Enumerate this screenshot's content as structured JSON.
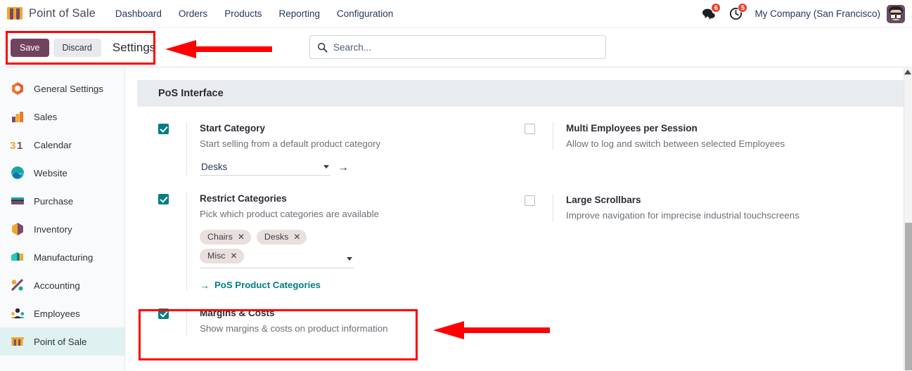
{
  "navbar": {
    "brand": "Point of Sale",
    "brand_icon": "shop-awning-icon",
    "menu": [
      {
        "label": "Dashboard"
      },
      {
        "label": "Orders"
      },
      {
        "label": "Products"
      },
      {
        "label": "Reporting"
      },
      {
        "label": "Configuration"
      }
    ],
    "messages_icon": "chat-bubbles-icon",
    "messages_count": "6",
    "activities_icon": "clock-icon",
    "activities_count": "5",
    "company": "My Company (San Francisco)",
    "avatar_icon": "user-avatar"
  },
  "control_panel": {
    "save_label": "Save",
    "discard_label": "Discard",
    "title": "Settings",
    "search_placeholder": "Search...",
    "search_value": "",
    "search_icon": "search-icon"
  },
  "sidebar": {
    "items": [
      {
        "label": "General Settings",
        "icon": "gear-settings-icon",
        "active": false
      },
      {
        "label": "Sales",
        "icon": "sales-bars-icon",
        "active": false
      },
      {
        "label": "Calendar",
        "icon": "calendar-31-icon",
        "active": false
      },
      {
        "label": "Website",
        "icon": "website-globe-icon",
        "active": false
      },
      {
        "label": "Purchase",
        "icon": "purchase-card-icon",
        "active": false
      },
      {
        "label": "Inventory",
        "icon": "inventory-box-icon",
        "active": false
      },
      {
        "label": "Manufacturing",
        "icon": "manufacturing-icon",
        "active": false
      },
      {
        "label": "Accounting",
        "icon": "accounting-percent-icon",
        "active": false
      },
      {
        "label": "Employees",
        "icon": "employees-people-icon",
        "active": false
      },
      {
        "label": "Point of Sale",
        "icon": "shop-awning-icon",
        "active": true
      }
    ]
  },
  "settings": {
    "section_title": "PoS Interface",
    "left": [
      {
        "id": "start-category",
        "checked": true,
        "title": "Start Category",
        "description": "Start selling from a default product category",
        "select_value": "Desks",
        "internal_link_icon": "arrow-right-icon"
      },
      {
        "id": "restrict-categories",
        "checked": true,
        "title": "Restrict Categories",
        "description": "Pick which product categories are available",
        "tags": [
          "Chairs",
          "Desks",
          "Misc"
        ],
        "link_label": "PoS Product Categories",
        "link_icon": "arrow-right-icon"
      },
      {
        "id": "margins-costs",
        "checked": true,
        "title": "Margins & Costs",
        "description": "Show margins & costs on product information"
      }
    ],
    "right": [
      {
        "id": "multi-employees",
        "checked": false,
        "title": "Multi Employees per Session",
        "description": "Allow to log and switch between selected Employees"
      },
      {
        "id": "large-scrollbars",
        "checked": false,
        "title": "Large Scrollbars",
        "description": "Improve navigation for imprecise industrial touchscreens"
      }
    ]
  },
  "annotations": {
    "color": "#ff0000",
    "boxes": [
      {
        "name": "save-discard-highlight"
      },
      {
        "name": "margins-costs-highlight"
      }
    ],
    "arrows": [
      {
        "name": "arrow-pointing-to-save-buttons"
      },
      {
        "name": "arrow-pointing-to-margins-costs"
      }
    ]
  },
  "colors": {
    "brand_purple": "#71435f",
    "accent_teal": "#017e84",
    "badge_red": "#e8412f",
    "annotation_red": "#ff0000",
    "sidebar_active": "#dff1f0",
    "tag_bg": "#e9dfdd"
  }
}
